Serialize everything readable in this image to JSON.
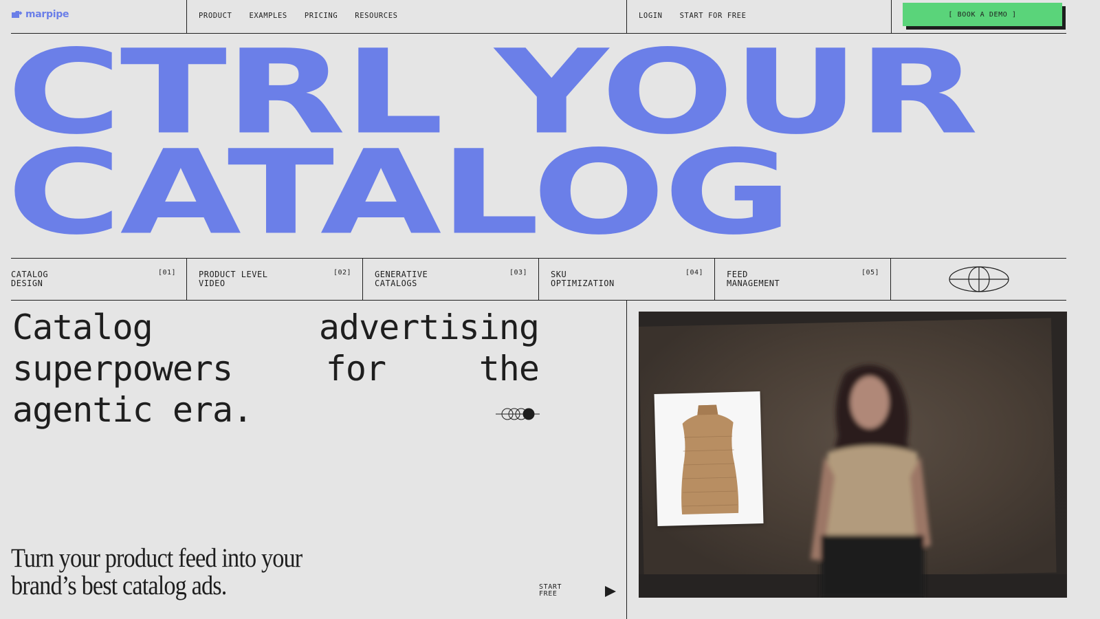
{
  "brand": {
    "name": "marpipe",
    "accent": "#6b7fe8",
    "cta_color": "#5ad47a"
  },
  "nav": {
    "items": [
      "PRODUCT",
      "EXAMPLES",
      "PRICING",
      "RESOURCES"
    ]
  },
  "account": {
    "login": "LOGIN",
    "start": "START FOR FREE"
  },
  "cta": {
    "label": "[ BOOK A DEMO ]"
  },
  "hero": {
    "line1": "CTRL YOUR",
    "line2": "CATALOG"
  },
  "features": [
    {
      "label": "CATALOG\nDESIGN",
      "num": "[01]"
    },
    {
      "label": "PRODUCT LEVEL\nVIDEO",
      "num": "[02]"
    },
    {
      "label": "GENERATIVE\nCATALOGS",
      "num": "[03]"
    },
    {
      "label": "SKU\nOPTIMIZATION",
      "num": "[04]"
    },
    {
      "label": "FEED\nMANAGEMENT",
      "num": "[05]"
    }
  ],
  "tagline": "Catalog advertising superpowers for the agentic era.",
  "subline": "Turn your product feed into your brand’s best catalog ads.",
  "start_free": "START\nFREE",
  "icons": {
    "logo": "folder-arrow-icon",
    "globe": "globe-icon",
    "carousel": "carousel-indicator-icon",
    "play": "play-icon"
  }
}
